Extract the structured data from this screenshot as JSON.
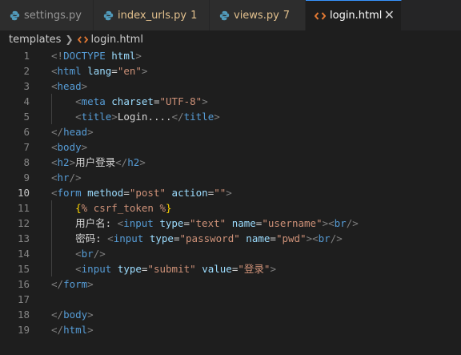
{
  "tabs": [
    {
      "label": "settings.py",
      "icon": "python-icon",
      "active": false,
      "modified": false,
      "count": ""
    },
    {
      "label": "index_urls.py",
      "icon": "python-icon",
      "active": false,
      "modified": true,
      "count": "1"
    },
    {
      "label": "views.py",
      "icon": "python-icon",
      "active": false,
      "modified": true,
      "count": "7"
    },
    {
      "label": "login.html",
      "icon": "html-icon",
      "active": true,
      "modified": false,
      "count": ""
    }
  ],
  "breadcrumb": {
    "folder": "templates",
    "file": "login.html"
  },
  "editor": {
    "current_line": 10,
    "lines": [
      {
        "n": "1",
        "tokens": [
          [
            "br",
            "<!"
          ],
          [
            "tag",
            "DOCTYPE"
          ],
          [
            "text",
            " "
          ],
          [
            "attr",
            "html"
          ],
          [
            "br",
            ">"
          ]
        ]
      },
      {
        "n": "2",
        "tokens": [
          [
            "br",
            "<"
          ],
          [
            "tag",
            "html"
          ],
          [
            "text",
            " "
          ],
          [
            "attr",
            "lang"
          ],
          [
            "text",
            "="
          ],
          [
            "str",
            "\"en\""
          ],
          [
            "br",
            ">"
          ]
        ]
      },
      {
        "n": "3",
        "tokens": [
          [
            "br",
            "<"
          ],
          [
            "tag",
            "head"
          ],
          [
            "br",
            ">"
          ]
        ]
      },
      {
        "n": "4",
        "tokens": [
          [
            "text",
            "    "
          ],
          [
            "br",
            "<"
          ],
          [
            "tag",
            "meta"
          ],
          [
            "text",
            " "
          ],
          [
            "attr",
            "charset"
          ],
          [
            "text",
            "="
          ],
          [
            "str",
            "\"UTF-8\""
          ],
          [
            "br",
            ">"
          ]
        ]
      },
      {
        "n": "5",
        "tokens": [
          [
            "text",
            "    "
          ],
          [
            "br",
            "<"
          ],
          [
            "tag",
            "title"
          ],
          [
            "br",
            ">"
          ],
          [
            "text",
            "Login...."
          ],
          [
            "br",
            "</"
          ],
          [
            "tag",
            "title"
          ],
          [
            "br",
            ">"
          ]
        ]
      },
      {
        "n": "6",
        "tokens": [
          [
            "br",
            "</"
          ],
          [
            "tag",
            "head"
          ],
          [
            "br",
            ">"
          ]
        ]
      },
      {
        "n": "7",
        "tokens": [
          [
            "br",
            "<"
          ],
          [
            "tag",
            "body"
          ],
          [
            "br",
            ">"
          ]
        ]
      },
      {
        "n": "8",
        "tokens": [
          [
            "br",
            "<"
          ],
          [
            "tag",
            "h2"
          ],
          [
            "br",
            ">"
          ],
          [
            "text",
            "用户登录"
          ],
          [
            "br",
            "</"
          ],
          [
            "tag",
            "h2"
          ],
          [
            "br",
            ">"
          ]
        ]
      },
      {
        "n": "9",
        "tokens": [
          [
            "br",
            "<"
          ],
          [
            "tag",
            "hr"
          ],
          [
            "br",
            "/>"
          ]
        ]
      },
      {
        "n": "10",
        "tokens": [
          [
            "br",
            "<"
          ],
          [
            "tag",
            "form"
          ],
          [
            "text",
            " "
          ],
          [
            "attr",
            "method"
          ],
          [
            "text",
            "="
          ],
          [
            "str",
            "\"post\""
          ],
          [
            "text",
            " "
          ],
          [
            "attr",
            "action"
          ],
          [
            "text",
            "="
          ],
          [
            "str",
            "\"\""
          ],
          [
            "br",
            ">"
          ]
        ]
      },
      {
        "n": "11",
        "tokens": [
          [
            "text",
            "    "
          ],
          [
            "brace",
            "{"
          ],
          [
            "tmpl",
            "% csrf_token %"
          ],
          [
            "brace",
            "}"
          ]
        ]
      },
      {
        "n": "12",
        "tokens": [
          [
            "text",
            "    用户名: "
          ],
          [
            "br",
            "<"
          ],
          [
            "tag",
            "input"
          ],
          [
            "text",
            " "
          ],
          [
            "attr",
            "type"
          ],
          [
            "text",
            "="
          ],
          [
            "str",
            "\"text\""
          ],
          [
            "text",
            " "
          ],
          [
            "attr",
            "name"
          ],
          [
            "text",
            "="
          ],
          [
            "str",
            "\"username\""
          ],
          [
            "br",
            "><"
          ],
          [
            "tag",
            "br"
          ],
          [
            "br",
            "/>"
          ]
        ]
      },
      {
        "n": "13",
        "tokens": [
          [
            "text",
            "    密码: "
          ],
          [
            "br",
            "<"
          ],
          [
            "tag",
            "input"
          ],
          [
            "text",
            " "
          ],
          [
            "attr",
            "type"
          ],
          [
            "text",
            "="
          ],
          [
            "str",
            "\"password\""
          ],
          [
            "text",
            " "
          ],
          [
            "attr",
            "name"
          ],
          [
            "text",
            "="
          ],
          [
            "str",
            "\"pwd\""
          ],
          [
            "br",
            "><"
          ],
          [
            "tag",
            "br"
          ],
          [
            "br",
            "/>"
          ]
        ]
      },
      {
        "n": "14",
        "tokens": [
          [
            "text",
            "    "
          ],
          [
            "br",
            "<"
          ],
          [
            "tag",
            "br"
          ],
          [
            "br",
            "/>"
          ]
        ]
      },
      {
        "n": "15",
        "tokens": [
          [
            "text",
            "    "
          ],
          [
            "br",
            "<"
          ],
          [
            "tag",
            "input"
          ],
          [
            "text",
            " "
          ],
          [
            "attr",
            "type"
          ],
          [
            "text",
            "="
          ],
          [
            "str",
            "\"submit\""
          ],
          [
            "text",
            " "
          ],
          [
            "attr",
            "value"
          ],
          [
            "text",
            "="
          ],
          [
            "str",
            "\"登录\""
          ],
          [
            "br",
            ">"
          ]
        ]
      },
      {
        "n": "16",
        "tokens": [
          [
            "br",
            "</"
          ],
          [
            "tag",
            "form"
          ],
          [
            "br",
            ">"
          ]
        ]
      },
      {
        "n": "17",
        "tokens": []
      },
      {
        "n": "18",
        "tokens": [
          [
            "br",
            "</"
          ],
          [
            "tag",
            "body"
          ],
          [
            "br",
            ">"
          ]
        ]
      },
      {
        "n": "19",
        "tokens": [
          [
            "br",
            "</"
          ],
          [
            "tag",
            "html"
          ],
          [
            "br",
            ">"
          ]
        ]
      }
    ]
  }
}
